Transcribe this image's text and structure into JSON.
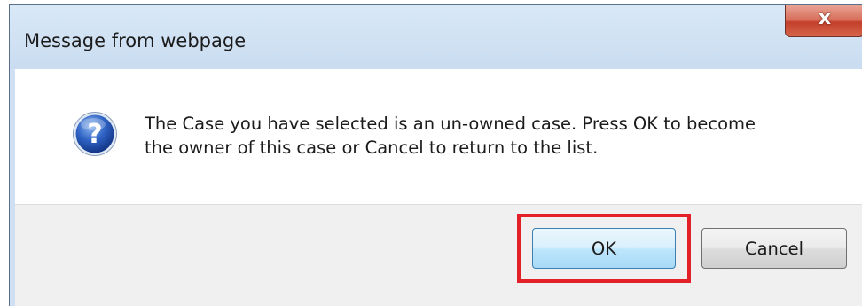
{
  "dialog": {
    "title": "Message from webpage",
    "close_label": "x",
    "icon": "question-icon",
    "message_line1": "The Case you have selected is an un-owned case. Press OK to become",
    "message_line2": "the owner of this case or Cancel to return to the list.",
    "buttons": {
      "ok_label": "OK",
      "cancel_label": "Cancel"
    },
    "highlight_color": "#e32028"
  }
}
